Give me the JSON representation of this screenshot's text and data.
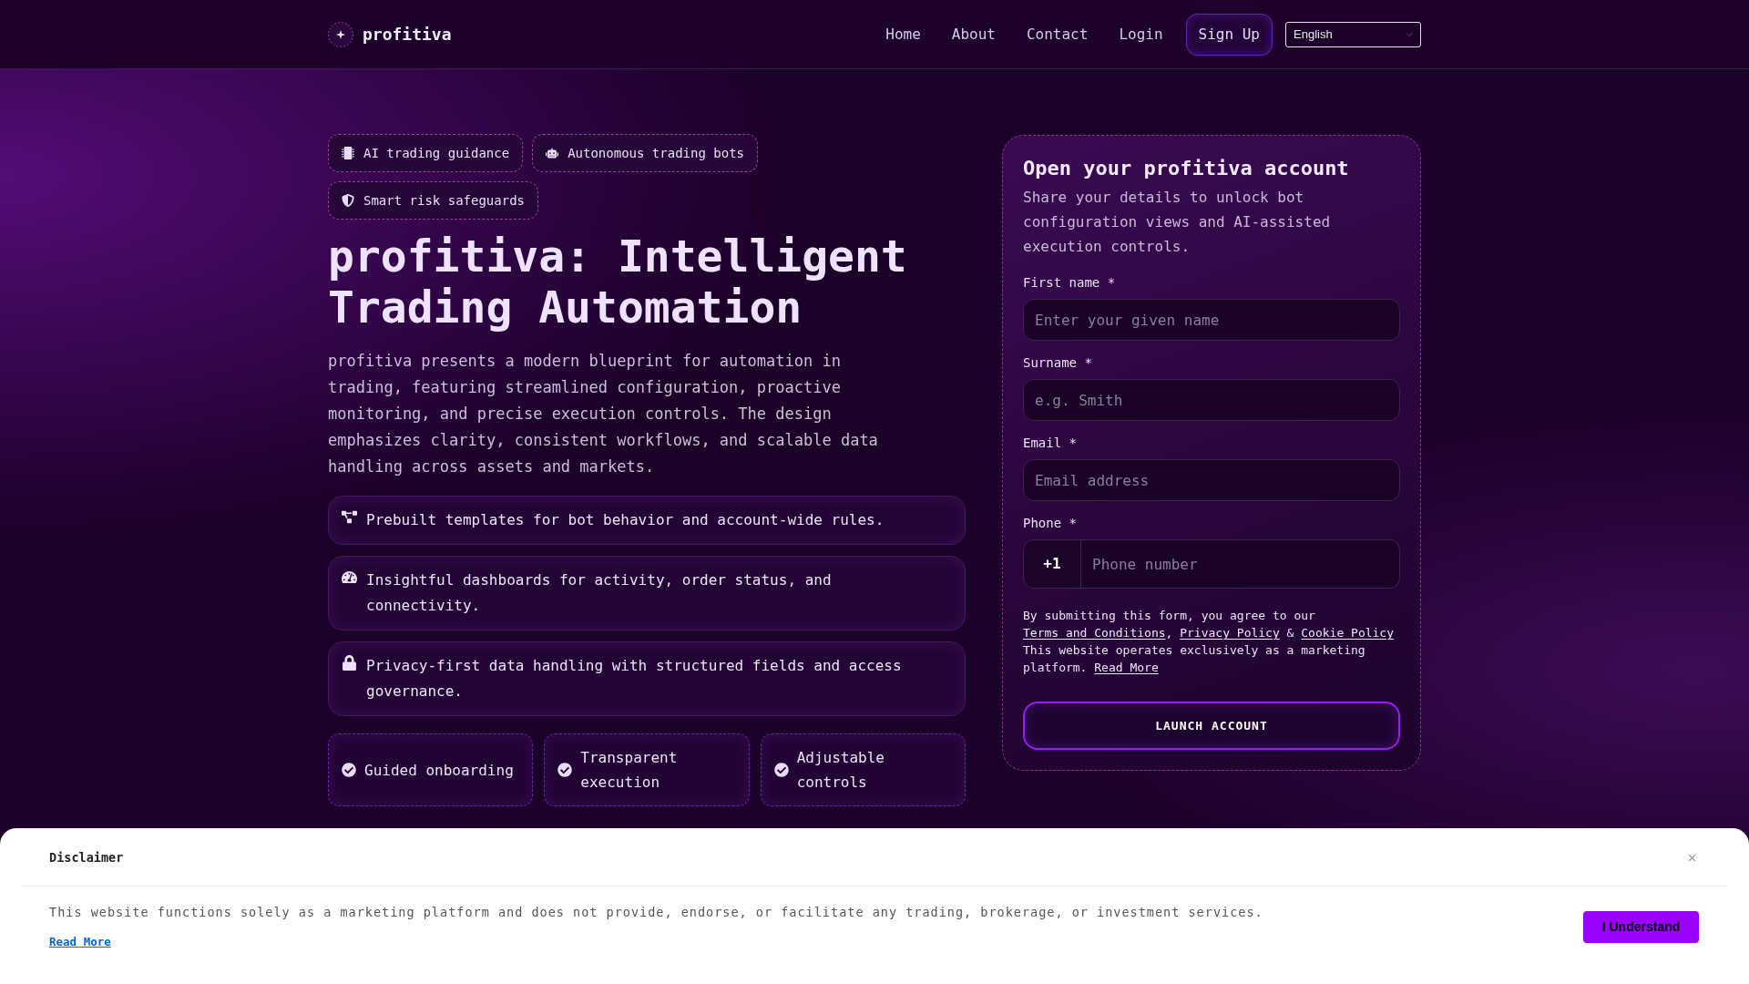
{
  "header": {
    "brand": "profitiva",
    "nav": [
      "Home",
      "About",
      "Contact",
      "Login"
    ],
    "sign_up": "Sign Up",
    "language_select": {
      "value": "English"
    }
  },
  "hero": {
    "badges": [
      "AI trading guidance",
      "Autonomous trading bots",
      "Smart risk safeguards"
    ],
    "title": "profitiva: Intelligent Trading Automation",
    "description": "profitiva presents a modern blueprint for automation in trading, featuring streamlined configuration, proactive monitoring, and precise execution controls. The design emphasizes clarity, consistent workflows, and scalable data handling across assets and markets.",
    "features": [
      "Prebuilt templates for bot behavior and account-wide rules.",
      "Insightful dashboards for activity, order status, and connectivity.",
      "Privacy-first data handling with structured fields and access governance."
    ],
    "highlights": [
      "Guided onboarding",
      "Transparent execution",
      "Adjustable controls"
    ]
  },
  "signup_form": {
    "title": "Open your profitiva account",
    "subtitle": "Share your details to unlock bot configuration views and AI-assisted execution controls.",
    "fields": [
      {
        "kind": "text",
        "label": "First name *",
        "placeholder": "Enter your given name"
      },
      {
        "kind": "text",
        "label": "Surname *",
        "placeholder": "e.g. Smith"
      },
      {
        "kind": "text",
        "label": "Email *",
        "placeholder": "Email address"
      },
      {
        "kind": "phone",
        "label": "Phone *",
        "prefix": "+1",
        "placeholder": "Phone number"
      }
    ],
    "consent": [
      {
        "kind": "text",
        "text": "By submitting this form, you agree to our "
      },
      {
        "kind": "link",
        "text": "Terms and Conditions"
      },
      {
        "kind": "text",
        "text": ", "
      },
      {
        "kind": "link",
        "text": "Privacy Policy"
      },
      {
        "kind": "text",
        "text": " & "
      },
      {
        "kind": "link",
        "text": "Cookie Policy"
      }
    ],
    "note": [
      {
        "kind": "text",
        "text": "This website operates exclusively as a marketing platform. "
      },
      {
        "kind": "link",
        "text": "Read More"
      }
    ],
    "submit": "LAUNCH ACCOUNT"
  },
  "disclaimer": {
    "title": "Disclaimer",
    "text": "This website functions solely as a marketing platform and does not provide, endorse, or facilitate any trading, brokerage, or investment services.",
    "link": "Read More",
    "button": "I Understand"
  }
}
